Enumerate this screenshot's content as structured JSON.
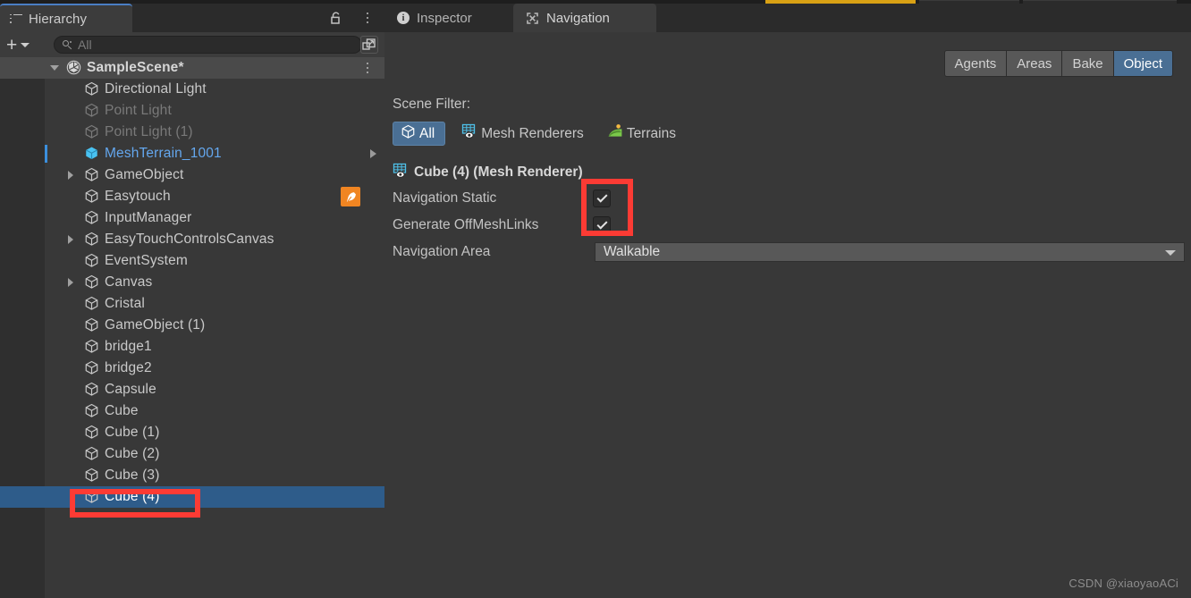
{
  "window": {
    "title": "Unity Editor"
  },
  "hierarchy": {
    "tab_label": "Hierarchy",
    "lock_icon": "unlock-icon",
    "menu_icon": "kebab-menu-icon",
    "toolbar": {
      "add_label": "+",
      "search_placeholder": "All",
      "search_value": "",
      "search_icon": "search-icon",
      "expand_icon": "open-in-new-icon"
    },
    "scene": {
      "name": "SampleScene*",
      "icon": "unity-scene-icon",
      "expanded": true
    },
    "items": [
      {
        "label": "Directional Light",
        "icon": "gameobject-cube-icon",
        "indent": 1,
        "dim": false,
        "twisty": "none",
        "selected": false,
        "accent": false
      },
      {
        "label": "Point Light",
        "icon": "gameobject-cube-icon",
        "indent": 1,
        "dim": true,
        "twisty": "none",
        "selected": false,
        "accent": false
      },
      {
        "label": "Point Light (1)",
        "icon": "gameobject-cube-icon",
        "indent": 1,
        "dim": true,
        "twisty": "none",
        "selected": false,
        "accent": false
      },
      {
        "label": "MeshTerrain_1001",
        "icon": "prefab-cube-icon",
        "indent": 1,
        "dim": false,
        "twisty": "none",
        "selected": false,
        "accent": true,
        "chevron": true,
        "marker": true
      },
      {
        "label": "GameObject",
        "icon": "gameobject-cube-icon",
        "indent": 1,
        "dim": false,
        "twisty": "closed",
        "selected": false,
        "accent": false
      },
      {
        "label": "Easytouch",
        "icon": "gameobject-cube-icon",
        "indent": 1,
        "dim": false,
        "twisty": "none",
        "selected": false,
        "accent": false,
        "badge": "easytouch-badge-icon"
      },
      {
        "label": "InputManager",
        "icon": "gameobject-cube-icon",
        "indent": 1,
        "dim": false,
        "twisty": "none",
        "selected": false,
        "accent": false
      },
      {
        "label": "EasyTouchControlsCanvas",
        "icon": "gameobject-cube-icon",
        "indent": 1,
        "dim": false,
        "twisty": "closed",
        "selected": false,
        "accent": false
      },
      {
        "label": "EventSystem",
        "icon": "gameobject-cube-icon",
        "indent": 1,
        "dim": false,
        "twisty": "none",
        "selected": false,
        "accent": false
      },
      {
        "label": "Canvas",
        "icon": "gameobject-cube-icon",
        "indent": 1,
        "dim": false,
        "twisty": "closed",
        "selected": false,
        "accent": false
      },
      {
        "label": "Cristal",
        "icon": "gameobject-cube-icon",
        "indent": 1,
        "dim": false,
        "twisty": "none",
        "selected": false,
        "accent": false
      },
      {
        "label": "GameObject (1)",
        "icon": "gameobject-cube-icon",
        "indent": 1,
        "dim": false,
        "twisty": "none",
        "selected": false,
        "accent": false
      },
      {
        "label": "bridge1",
        "icon": "gameobject-cube-icon",
        "indent": 1,
        "dim": false,
        "twisty": "none",
        "selected": false,
        "accent": false
      },
      {
        "label": "bridge2",
        "icon": "gameobject-cube-icon",
        "indent": 1,
        "dim": false,
        "twisty": "none",
        "selected": false,
        "accent": false
      },
      {
        "label": "Capsule",
        "icon": "gameobject-cube-icon",
        "indent": 1,
        "dim": false,
        "twisty": "none",
        "selected": false,
        "accent": false
      },
      {
        "label": "Cube",
        "icon": "gameobject-cube-icon",
        "indent": 1,
        "dim": false,
        "twisty": "none",
        "selected": false,
        "accent": false
      },
      {
        "label": "Cube (1)",
        "icon": "gameobject-cube-icon",
        "indent": 1,
        "dim": false,
        "twisty": "none",
        "selected": false,
        "accent": false
      },
      {
        "label": "Cube (2)",
        "icon": "gameobject-cube-icon",
        "indent": 1,
        "dim": false,
        "twisty": "none",
        "selected": false,
        "accent": false
      },
      {
        "label": "Cube (3)",
        "icon": "gameobject-cube-icon",
        "indent": 1,
        "dim": false,
        "twisty": "none",
        "selected": false,
        "accent": false
      },
      {
        "label": "Cube (4)",
        "icon": "gameobject-cube-icon",
        "indent": 1,
        "dim": false,
        "twisty": "none",
        "selected": true,
        "accent": false
      }
    ]
  },
  "inspector": {
    "tabs": [
      {
        "label": "Inspector",
        "icon": "info-icon",
        "active": false
      },
      {
        "label": "Navigation",
        "icon": "navigation-icon",
        "active": true
      }
    ],
    "menu_icon": "kebab-menu-icon"
  },
  "navigation": {
    "segments": [
      {
        "label": "Agents",
        "active": false
      },
      {
        "label": "Areas",
        "active": false
      },
      {
        "label": "Bake",
        "active": false
      },
      {
        "label": "Object",
        "active": true
      }
    ],
    "scene_filter_label": "Scene Filter:",
    "filters": [
      {
        "label": "All",
        "icon": "cube-icon",
        "active": true
      },
      {
        "label": "Mesh Renderers",
        "icon": "mesh-renderer-icon",
        "active": false
      },
      {
        "label": "Terrains",
        "icon": "terrain-icon",
        "active": false
      }
    ],
    "object_header": {
      "label": "Cube (4)  (Mesh Renderer)",
      "icon": "mesh-renderer-icon"
    },
    "properties": [
      {
        "label": "Navigation Static",
        "type": "checkbox",
        "checked": true
      },
      {
        "label": "Generate OffMeshLinks",
        "type": "checkbox",
        "checked": true
      },
      {
        "label": "Navigation Area",
        "type": "dropdown",
        "value": "Walkable"
      }
    ]
  },
  "watermark": "CSDN @xiaoyaoACi",
  "colors": {
    "panel_bg": "#383838",
    "tabbar_bg": "#2b2b2b",
    "selection_blue": "#2e5c8a",
    "accent_blue": "#64a7ee",
    "segment_active": "#4a6f94",
    "annotation_red": "#fc3b34",
    "badge_orange": "#f08522",
    "gold_strip": "#d9a114"
  }
}
